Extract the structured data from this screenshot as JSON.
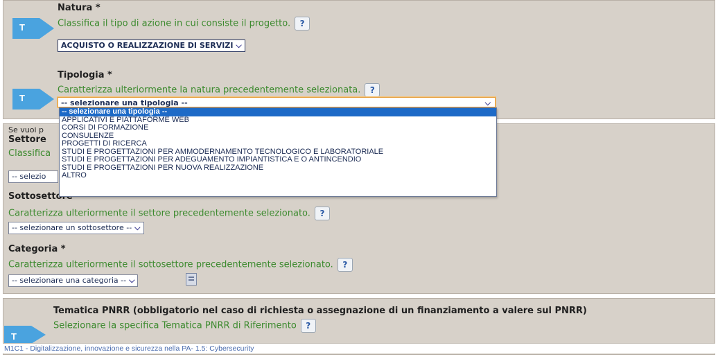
{
  "natura": {
    "label": "Natura *",
    "description": "Classifica il tipo di azione in cui consiste il progetto.",
    "selected": "ACQUISTO O REALIZZAZIONE DI SERVIZI"
  },
  "tipologia": {
    "label": "Tipologia *",
    "description": "Caratterizza ulteriormente la natura precedentemente selezionata.",
    "selected": "-- selezionare una tipologia --",
    "options": [
      "-- selezionare una tipologia --",
      "APPLICATIVI E PIATTAFORME WEB",
      "CORSI DI FORMAZIONE",
      "CONSULENZE",
      "PROGETTI DI RICERCA",
      "STUDI E PROGETTAZIONI PER AMMODERNAMENTO TECNOLOGICO E LABORATORIALE",
      "STUDI E PROGETTAZIONI PER ADEGUAMENTO IMPIANTISTICA E O ANTINCENDIO",
      "STUDI E PROGETTAZIONI PER NUOVA REALIZZAZIONE",
      "ALTRO"
    ]
  },
  "settore": {
    "intro": "Se vuoi p",
    "label": "Settore",
    "description": "Classifica",
    "select": "-- selezio"
  },
  "sottosettore": {
    "label": "Sottosettore *",
    "description": "Caratterizza ulteriormente il settore precedentemente selezionato.",
    "selected": "-- selezionare un sottosettore --"
  },
  "categoria": {
    "label": "Categoria *",
    "description": "Caratterizza ulteriormente il sottosettore precedentemente selezionato.",
    "selected": "-- selezionare una categoria --"
  },
  "tematica": {
    "label": "Tematica PNRR (obbligatorio nel caso di richiesta o assegnazione di un finanziamento a valere sul PNRR)",
    "description": "Selezionare la specifica Tematica PNRR di Riferimento",
    "option": "M1C1 - Digitalizzazione, innovazione e sicurezza nella PA- 1.5: Cybersecurity"
  },
  "ui": {
    "help": "?",
    "arrow_letter": "T",
    "chevron": "⌵"
  },
  "colors": {
    "panel": "#d7d1c9",
    "description_green": "#3c8a2e",
    "arrow_blue": "#4aa3df",
    "selected_option": "#1d6ac7"
  }
}
